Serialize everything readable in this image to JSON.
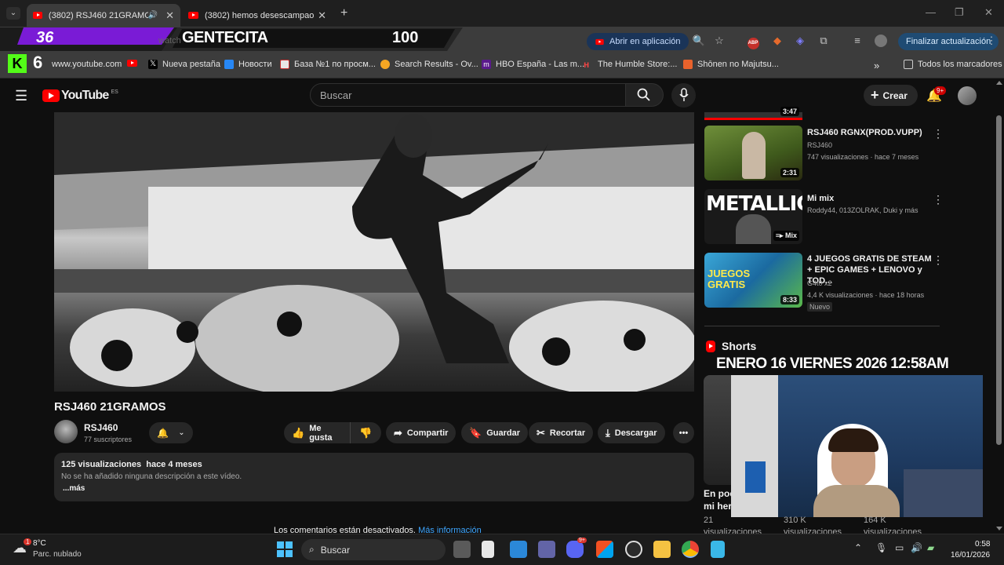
{
  "browser": {
    "tabs": [
      {
        "title": "(3802) RSJ460 21GRAMOS",
        "active": true
      },
      {
        "title": "(3802) hemos desescampao de",
        "active": false
      }
    ],
    "overlay": {
      "left_num": "36",
      "name": "GENTECITA",
      "right_num": "100",
      "bar_text": "watch",
      "stat_num": "6"
    },
    "open_in_app_label": "Abrir en aplicación",
    "update_label": "Finalizar actualización",
    "bookmarks": [
      "www.youtube.com",
      "Nueva pestaña",
      "Новости",
      "База №1 по просм...",
      "Search Results - Ov...",
      "HBO España - Las m...",
      "The Humble Store:...",
      "Shōnen no Majutsu..."
    ],
    "all_bookmarks_label": "Todos los marcadores"
  },
  "youtube": {
    "logo_text": "YouTube",
    "region": "ES",
    "search_placeholder": "Buscar",
    "create_label": "Crear",
    "notif_badge": "9+"
  },
  "video": {
    "title": "RSJ460 21GRAMOS",
    "channel": "RSJ460",
    "subscribers": "77 suscriptores",
    "like_label": "Me gusta",
    "share_label": "Compartir",
    "save_label": "Guardar",
    "clip_label": "Recortar",
    "download_label": "Descargar",
    "views_line": "125 visualizaciones  hace 4 meses",
    "description": "No se ha añadido ninguna descripción a este vídeo.",
    "more_label": "...más",
    "comments_off": "Los comentarios están desactivados.",
    "more_info": "Más información"
  },
  "recommendations": [
    {
      "title": "RSJ460 RGNX(PROD.VUPP)",
      "channel": "RSJ460",
      "meta": "747 visualizaciones · hace 7 meses",
      "duration": "2:31"
    },
    {
      "title": "Mi mix",
      "channel": "Roddy44, 013ZOLRAK, Duki y más",
      "meta": "",
      "duration": "Mix",
      "thumb_text": "METALLIC"
    },
    {
      "title": "4 JUEGOS GRATIS DE STEAM + EPIC GAMES + LENOVO y TOD...",
      "channel": "G4t0 x2",
      "meta": "4,4 K visualizaciones · hace 18 horas",
      "duration": "8:33",
      "badge": "Nuevo",
      "thumb_text": "JUEGOS GRATIS"
    }
  ],
  "prev_duration": "3:47",
  "shorts": {
    "label": "Shorts",
    "overlay_text": "ENERO 16 VIERNES 2026 12:58AM",
    "short_title": "En poc",
    "short_title2": "mi her",
    "counts": [
      "21",
      "310 K",
      "164 K"
    ],
    "count_suffix": "visualizaciones"
  },
  "taskbar": {
    "temp": "8°C",
    "weather": "Parc. nublado",
    "search": "Buscar",
    "time": "0:58",
    "date": "16/01/2026",
    "badge_weather": "1",
    "badge_discord": "9+"
  }
}
